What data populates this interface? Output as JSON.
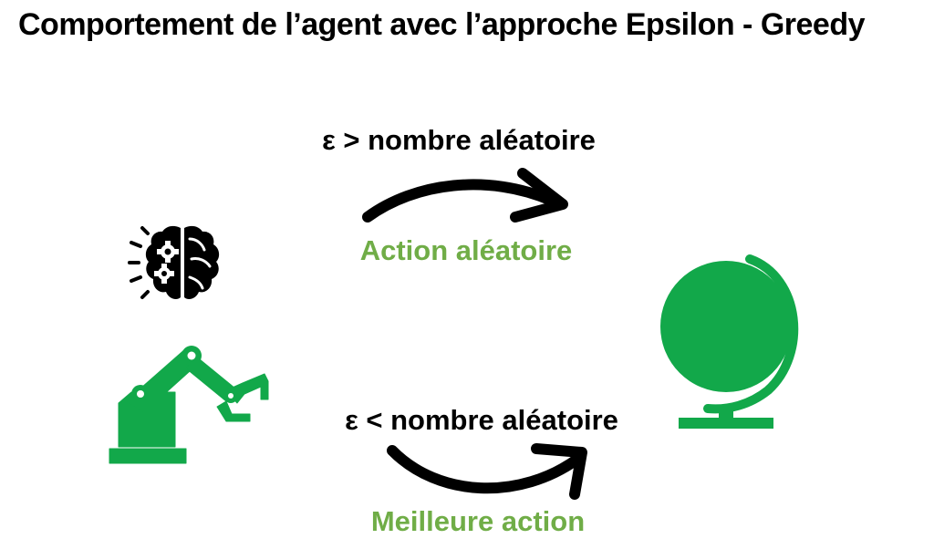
{
  "title": "Comportement de l’agent avec l’approche Epsilon - Greedy",
  "branches": [
    {
      "condition": "ε > nombre aléatoire",
      "action": "Action aléatoire"
    },
    {
      "condition": "ε < nombre aléatoire",
      "action": "Meilleure action"
    }
  ],
  "icons": {
    "agent_brain": "brain-gears-icon",
    "agent_body": "robotic-arm-icon",
    "environment": "globe-icon"
  },
  "colors": {
    "text": "#000000",
    "accent_text": "#70ad47",
    "icon_green": "#12a84a",
    "arrow": "#000000"
  }
}
